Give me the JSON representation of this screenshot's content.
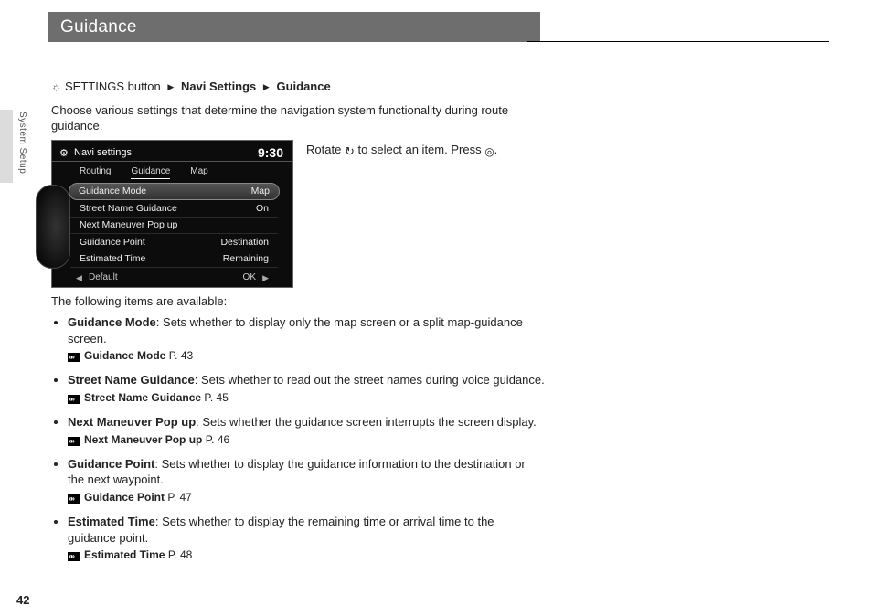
{
  "header": {
    "title": "Guidance"
  },
  "side_tab": "System Setup",
  "page_number": "42",
  "breadcrumb": {
    "prefix": "SETTINGS button",
    "items": [
      "Navi Settings",
      "Guidance"
    ]
  },
  "intro": "Choose various settings that determine the navigation system functionality during route guidance.",
  "instructions": {
    "rotate": "Rotate",
    "to_select": " to select an item. Press ",
    "period": "."
  },
  "screenshot": {
    "title": "Navi settings",
    "time": "9:30",
    "tabs": [
      "Routing",
      "Guidance",
      "Map"
    ],
    "selected_tab": 1,
    "menu": [
      {
        "label": "Guidance Mode",
        "value": "Map",
        "selected": true
      },
      {
        "label": "Street Name Guidance",
        "value": "On"
      },
      {
        "label": "Next Maneuver Pop up",
        "value": ""
      },
      {
        "label": "Guidance Point",
        "value": "Destination"
      },
      {
        "label": "Estimated Time",
        "value": "Remaining"
      }
    ],
    "bottom": {
      "left": "Default",
      "right": "OK"
    }
  },
  "available_intro": "The following items are available:",
  "items": [
    {
      "name": "Guidance Mode",
      "desc": ": Sets whether to display only the map screen or a split map-guidance screen.",
      "xref_label": "Guidance Mode",
      "xref_page": "P. 43"
    },
    {
      "name": "Street Name Guidance",
      "desc": ": Sets whether to read out the street names during voice guidance.",
      "xref_label": "Street Name Guidance",
      "xref_page": "P. 45"
    },
    {
      "name": "Next Maneuver Pop up",
      "desc": ": Sets whether the guidance screen interrupts the screen display.",
      "xref_label": "Next Maneuver Pop up",
      "xref_page": "P. 46"
    },
    {
      "name": "Guidance Point",
      "desc": ": Sets whether to display the guidance information to the destination or the next waypoint.",
      "xref_label": "Guidance Point",
      "xref_page": "P. 47"
    },
    {
      "name": "Estimated Time",
      "desc": ": Sets whether to display the remaining time or arrival time to the guidance point.",
      "xref_label": "Estimated Time",
      "xref_page": "P. 48"
    }
  ]
}
